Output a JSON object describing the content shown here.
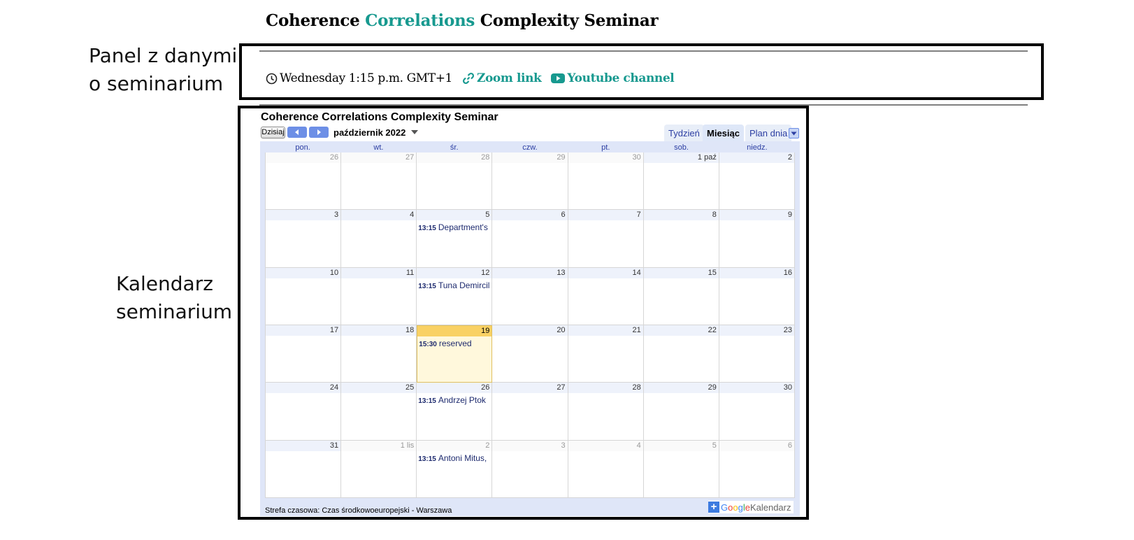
{
  "title": {
    "part1": "Coherence",
    "part2": "Correlations",
    "part3": "Complexity Seminar",
    "accent_color": "#17998f"
  },
  "annotations": {
    "panel_line1": "Panel z danymi",
    "panel_line2": "o seminarium",
    "calendar_line1": "Kalendarz",
    "calendar_line2": "seminarium"
  },
  "info_panel": {
    "schedule": "Wednesday 1:15 p.m. GMT+1",
    "zoom_link": "Zoom link",
    "youtube_link": "Youtube channel",
    "icons": [
      "clock-icon",
      "link-icon",
      "youtube-icon"
    ]
  },
  "calendar": {
    "title": "Coherence Correlations Complexity Seminar",
    "today_button": "Dzisiaj",
    "month_label": "październik 2022",
    "tabs": [
      {
        "label": "Tydzień",
        "active": false
      },
      {
        "label": "Miesiąc",
        "active": true
      },
      {
        "label": "Plan dnia",
        "active": false
      }
    ],
    "weekdays": [
      "pon.",
      "wt.",
      "śr.",
      "czw.",
      "pt.",
      "sob.",
      "niedz."
    ],
    "weeks": [
      [
        {
          "d": "26",
          "o": true
        },
        {
          "d": "27",
          "o": true
        },
        {
          "d": "28",
          "o": true
        },
        {
          "d": "29",
          "o": true
        },
        {
          "d": "30",
          "o": true
        },
        {
          "d": "1 paź"
        },
        {
          "d": "2"
        }
      ],
      [
        {
          "d": "3"
        },
        {
          "d": "4"
        },
        {
          "d": "5",
          "e": {
            "time": "13:15",
            "title": "Department's"
          }
        },
        {
          "d": "6"
        },
        {
          "d": "7"
        },
        {
          "d": "8"
        },
        {
          "d": "9"
        }
      ],
      [
        {
          "d": "10"
        },
        {
          "d": "11"
        },
        {
          "d": "12",
          "e": {
            "time": "13:15",
            "title": "Tuna Demircil"
          }
        },
        {
          "d": "13"
        },
        {
          "d": "14"
        },
        {
          "d": "15"
        },
        {
          "d": "16"
        }
      ],
      [
        {
          "d": "17"
        },
        {
          "d": "18"
        },
        {
          "d": "19",
          "today": true,
          "e": {
            "time": "15:30",
            "title": "reserved"
          }
        },
        {
          "d": "20"
        },
        {
          "d": "21"
        },
        {
          "d": "22"
        },
        {
          "d": "23"
        }
      ],
      [
        {
          "d": "24"
        },
        {
          "d": "25"
        },
        {
          "d": "26",
          "e": {
            "time": "13:15",
            "title": "Andrzej Ptok"
          }
        },
        {
          "d": "27"
        },
        {
          "d": "28"
        },
        {
          "d": "29"
        },
        {
          "d": "30"
        }
      ],
      [
        {
          "d": "31"
        },
        {
          "d": "1 lis",
          "o": true
        },
        {
          "d": "2",
          "o": true,
          "e": {
            "time": "13:15",
            "title": "Antoni Mitus,"
          }
        },
        {
          "d": "3",
          "o": true
        },
        {
          "d": "4",
          "o": true
        },
        {
          "d": "5",
          "o": true
        },
        {
          "d": "6",
          "o": true
        }
      ]
    ],
    "timezone": "Strefa czasowa: Czas środkowoeuropejski - Warszawa",
    "badge": {
      "plus": "+",
      "google": "Google",
      "product": "Kalendarz"
    }
  }
}
